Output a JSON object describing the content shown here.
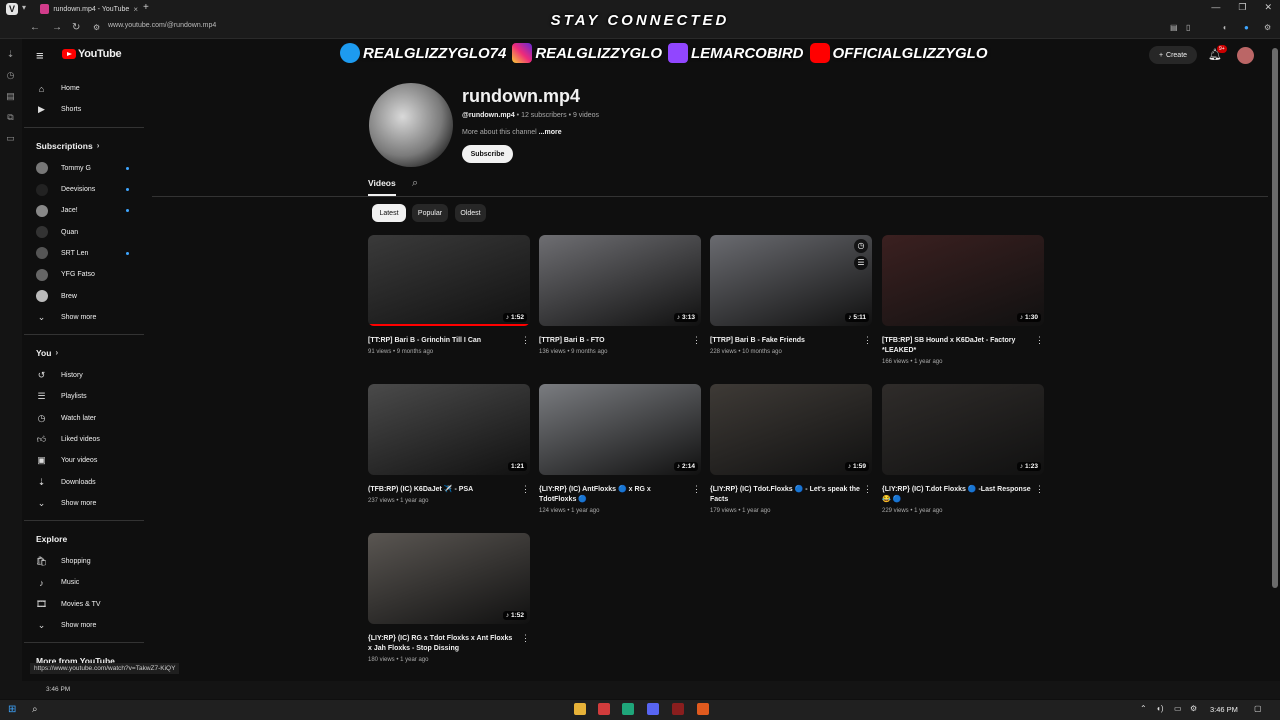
{
  "browser": {
    "tab_title": "rundown.mp4 - YouTube",
    "url": "www.youtube.com/@rundown.mp4",
    "status_url": "https://www.youtube.com/watch?v=TakwZ7-KiQY",
    "clock": "3:46 PM"
  },
  "overlay": {
    "title": "STAY CONNECTED",
    "handles": [
      {
        "icon": "twitter-icon",
        "text": "REALGLIZZYGLO74"
      },
      {
        "icon": "instagram-icon",
        "text": "REALGLIZZYGLO"
      },
      {
        "icon": "twitch-icon",
        "text": "LEMARCOBIRD"
      },
      {
        "icon": "youtube-icon",
        "text": "OFFICIALGLIZZYGLO"
      }
    ]
  },
  "header": {
    "logo": "YouTube",
    "create": "Create",
    "notifications": "9+"
  },
  "sidebar": {
    "main": [
      {
        "icon": "home-icon",
        "label": "Home"
      },
      {
        "icon": "shorts-icon",
        "label": "Shorts"
      }
    ],
    "subscriptions_title": "Subscriptions",
    "subscriptions": [
      {
        "label": "Tommy G",
        "dot": true
      },
      {
        "label": "Deevisions",
        "dot": true
      },
      {
        "label": "Jace!",
        "dot": true
      },
      {
        "label": "Quan",
        "dot": false
      },
      {
        "label": "SRT Len",
        "dot": true
      },
      {
        "label": "YFG Fatso",
        "dot": false
      },
      {
        "label": "Brew",
        "dot": false
      }
    ],
    "show_more": "Show more",
    "you_title": "You",
    "you": [
      {
        "icon": "history-icon",
        "label": "History"
      },
      {
        "icon": "playlists-icon",
        "label": "Playlists"
      },
      {
        "icon": "watch-later-icon",
        "label": "Watch later"
      },
      {
        "icon": "liked-icon",
        "label": "Liked videos"
      },
      {
        "icon": "your-videos-icon",
        "label": "Your videos"
      },
      {
        "icon": "downloads-icon",
        "label": "Downloads"
      }
    ],
    "explore_title": "Explore",
    "explore": [
      {
        "icon": "shopping-icon",
        "label": "Shopping"
      },
      {
        "icon": "music-icon",
        "label": "Music"
      },
      {
        "icon": "movies-icon",
        "label": "Movies & TV"
      }
    ],
    "more_from": "More from YouTube"
  },
  "channel": {
    "name": "rundown.mp4",
    "handle": "@rundown.mp4",
    "subscribers": "12 subscribers",
    "videos_count": "9 videos",
    "desc": "More about this channel",
    "more": "...more",
    "subscribe": "Subscribe",
    "tab": "Videos"
  },
  "filters": [
    "Latest",
    "Popular",
    "Oldest"
  ],
  "videos": [
    {
      "title": "[TT:RP] Bari B - Grinchin Till I Can",
      "views": "91 views",
      "age": "9 months ago",
      "duration": "1:52",
      "watched": true,
      "bg": "#3a3a3a"
    },
    {
      "title": "[TTRP] Bari B - FTO",
      "views": "136 views",
      "age": "9 months ago",
      "duration": "3:13",
      "watched": false,
      "bg": "#6e6e72"
    },
    {
      "title": "[TTRP] Bari B - Fake Friends",
      "views": "228 views",
      "age": "10 months ago",
      "duration": "5:11",
      "watched": false,
      "bg": "#6a6b70"
    },
    {
      "title": "[TFB:RP] SB Hound x K6DaJet - Factory *LEAKED*",
      "views": "166 views",
      "age": "1 year ago",
      "duration": "1:30",
      "watched": false,
      "bg": "#3b2020"
    },
    {
      "title": "(TFB:RP) (IC) K6DaJet ✈️ - PSA",
      "views": "237 views",
      "age": "1 year ago",
      "duration": "1:21",
      "watched": false,
      "bg": "#4a4a4a"
    },
    {
      "title": "{LIY:RP} (IC) AntFloxks 🔵 x RG x TdotFloxks 🔵",
      "views": "124 views",
      "age": "1 year ago",
      "duration": "2:14",
      "watched": false,
      "bg": "#7a7c80"
    },
    {
      "title": "{LIY:RP} (IC) Tdot.Floxks 🔵 - Let's speak the Facts",
      "views": "179 views",
      "age": "1 year ago",
      "duration": "1:59",
      "watched": false,
      "bg": "#3e3a36"
    },
    {
      "title": "{LIY:RP} (IC) T.dot Floxks 🔵 -Last Response 😂 🔵",
      "views": "229 views",
      "age": "1 year ago",
      "duration": "1:23",
      "watched": false,
      "bg": "#2f2c2a"
    },
    {
      "title": "{LIY:RP} (IC) RG x Tdot Floxks x Ant Floxks x Jah Floxks - Stop Dissing",
      "views": "180 views",
      "age": "1 year ago",
      "duration": "1:52",
      "watched": false,
      "bg": "#5a5652"
    }
  ],
  "taskbar": {
    "time": "3:46 PM"
  },
  "colors": {
    "accent": "#ff0000",
    "link": "#3ea6ff",
    "bg": "#0f0f0f"
  }
}
